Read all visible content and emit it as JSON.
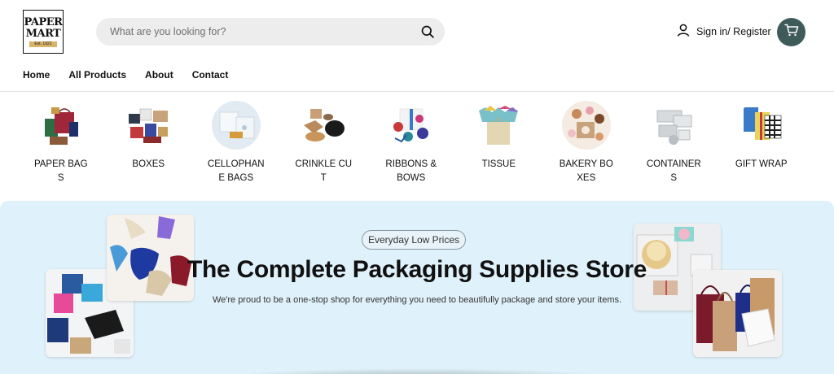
{
  "header": {
    "logo": {
      "line1": "PAPER",
      "line2": "MART",
      "est": "Est. 1921"
    },
    "search": {
      "placeholder": "What are you looking for?"
    },
    "account": {
      "label": "Sign in/ Register"
    }
  },
  "nav": {
    "items": [
      {
        "label": "Home"
      },
      {
        "label": "All Products"
      },
      {
        "label": "About"
      },
      {
        "label": "Contact"
      }
    ]
  },
  "categories": [
    {
      "label": "PAPER BAGS"
    },
    {
      "label": "BOXES"
    },
    {
      "label": "CELLOPHANE BAGS"
    },
    {
      "label": "CRINKLE CUT"
    },
    {
      "label": "RIBBONS & BOWS"
    },
    {
      "label": "TISSUE"
    },
    {
      "label": "BAKERY BOXES"
    },
    {
      "label": "CONTAINERS"
    },
    {
      "label": "GIFT WRAP"
    }
  ],
  "hero": {
    "badge": "Everyday Low Prices",
    "title": "The Complete Packaging Supplies Store",
    "subtitle": "We're proud to be a one-stop shop for everything you need to beautifully package and store your items."
  },
  "colors": {
    "cart_bg": "#3e5b5a",
    "hero_bg": "#dff1fa",
    "search_bg": "#ededed"
  },
  "icons": {
    "search": "search-icon",
    "user": "user-icon",
    "cart": "cart-icon"
  }
}
